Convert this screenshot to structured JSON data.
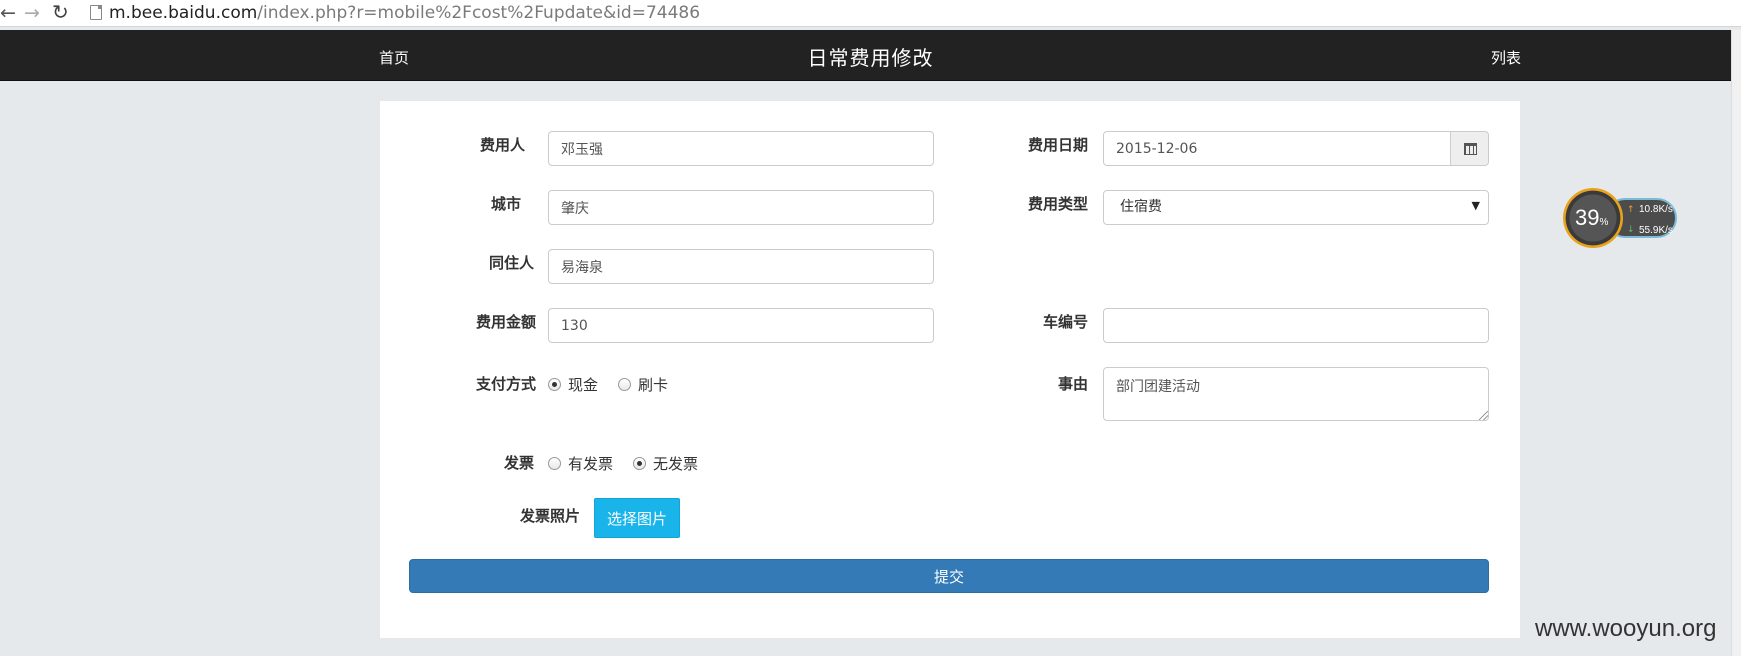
{
  "browser": {
    "url_host": "m.bee.baidu.com",
    "url_path": "/index.php?r=mobile%2Fcost%2Fupdate&id=74486"
  },
  "navbar": {
    "home": "首页",
    "title": "日常费用修改",
    "list": "列表"
  },
  "form": {
    "payer": {
      "label": "费用人",
      "value": "邓玉强"
    },
    "cost_date": {
      "label": "费用日期",
      "value": "2015-12-06"
    },
    "city": {
      "label": "城市",
      "value": "肇庆"
    },
    "cost_type": {
      "label": "费用类型",
      "value": "住宿费"
    },
    "roommate": {
      "label": "同住人",
      "value": "易海泉"
    },
    "amount": {
      "label": "费用金额",
      "value": "130"
    },
    "car_no": {
      "label": "车编号",
      "value": ""
    },
    "payment": {
      "label": "支付方式",
      "options": [
        {
          "label": "现金",
          "checked": true
        },
        {
          "label": "刷卡",
          "checked": false
        }
      ]
    },
    "reason": {
      "label": "事由",
      "value": "部门团建活动"
    },
    "invoice": {
      "label": "发票",
      "options": [
        {
          "label": "有发票",
          "checked": false
        },
        {
          "label": "无发票",
          "checked": true
        }
      ]
    },
    "invoice_photo": {
      "label": "发票照片",
      "button": "选择图片"
    },
    "submit": "提交"
  },
  "speed_widget": {
    "percent": "39",
    "percent_sign": "%",
    "upload": "10.8K/s",
    "download": "55.9K/s"
  },
  "watermark": "www.wooyun.org"
}
